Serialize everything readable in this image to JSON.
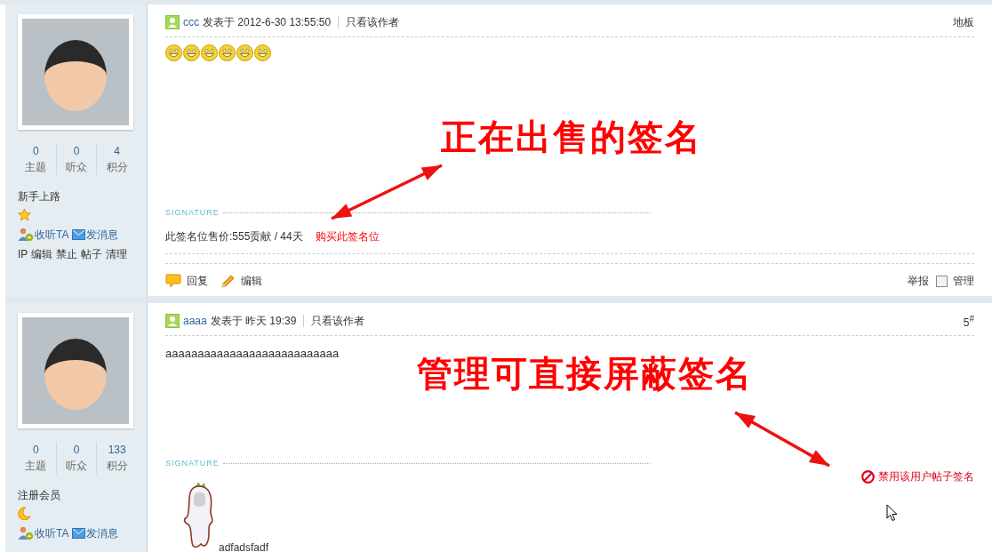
{
  "posts": [
    {
      "author": "ccc",
      "posted_label": "发表于",
      "time": "2012-6-30 13:55:50",
      "only_author": "只看该作者",
      "floor": "地板",
      "stats": [
        {
          "value": "0",
          "label": "主题"
        },
        {
          "value": "0",
          "label": "听众"
        },
        {
          "value": "4",
          "label": "积分"
        }
      ],
      "group": "新手上路",
      "rank": {
        "kind": "star"
      },
      "actions": [
        "收听TA",
        "发消息"
      ],
      "admin_links": [
        "IP",
        "编辑",
        "禁止",
        "帖子",
        "清理"
      ],
      "content": {
        "kind": "smileys"
      },
      "signature": {
        "label": "SIGNATURE",
        "kind": "sale",
        "text": "此签名位售价:555贡献 / 44天",
        "link": "购买此签名位"
      },
      "footer": {
        "actions": [
          "回复",
          "编辑"
        ],
        "report": "举报",
        "manage": {
          "label": "管理",
          "checked": false
        }
      },
      "annotation": {
        "text": "正在出售的签名"
      }
    },
    {
      "author": "aaaa",
      "posted_label": "发表于",
      "time": "昨天 19:39",
      "only_author": "只看该作者",
      "floor": "5$^{#}$",
      "stats": [
        {
          "value": "0",
          "label": "主题"
        },
        {
          "value": "0",
          "label": "听众"
        },
        {
          "value": "133",
          "label": "积分"
        }
      ],
      "group": "注册会员",
      "rank": {
        "kind": "moon"
      },
      "actions": [
        "收听TA",
        "发消息"
      ],
      "content": {
        "kind": "text",
        "text": "aaaaaaaaaaaaaaaaaaaaaaaaaaa"
      },
      "signature": {
        "label": "SIGNATURE",
        "kind": "image",
        "caption": "adfadsfadf",
        "moderation": "禁用该用户帖子签名"
      },
      "annotation": {
        "text": "管理可直接屏蔽签名"
      }
    }
  ]
}
